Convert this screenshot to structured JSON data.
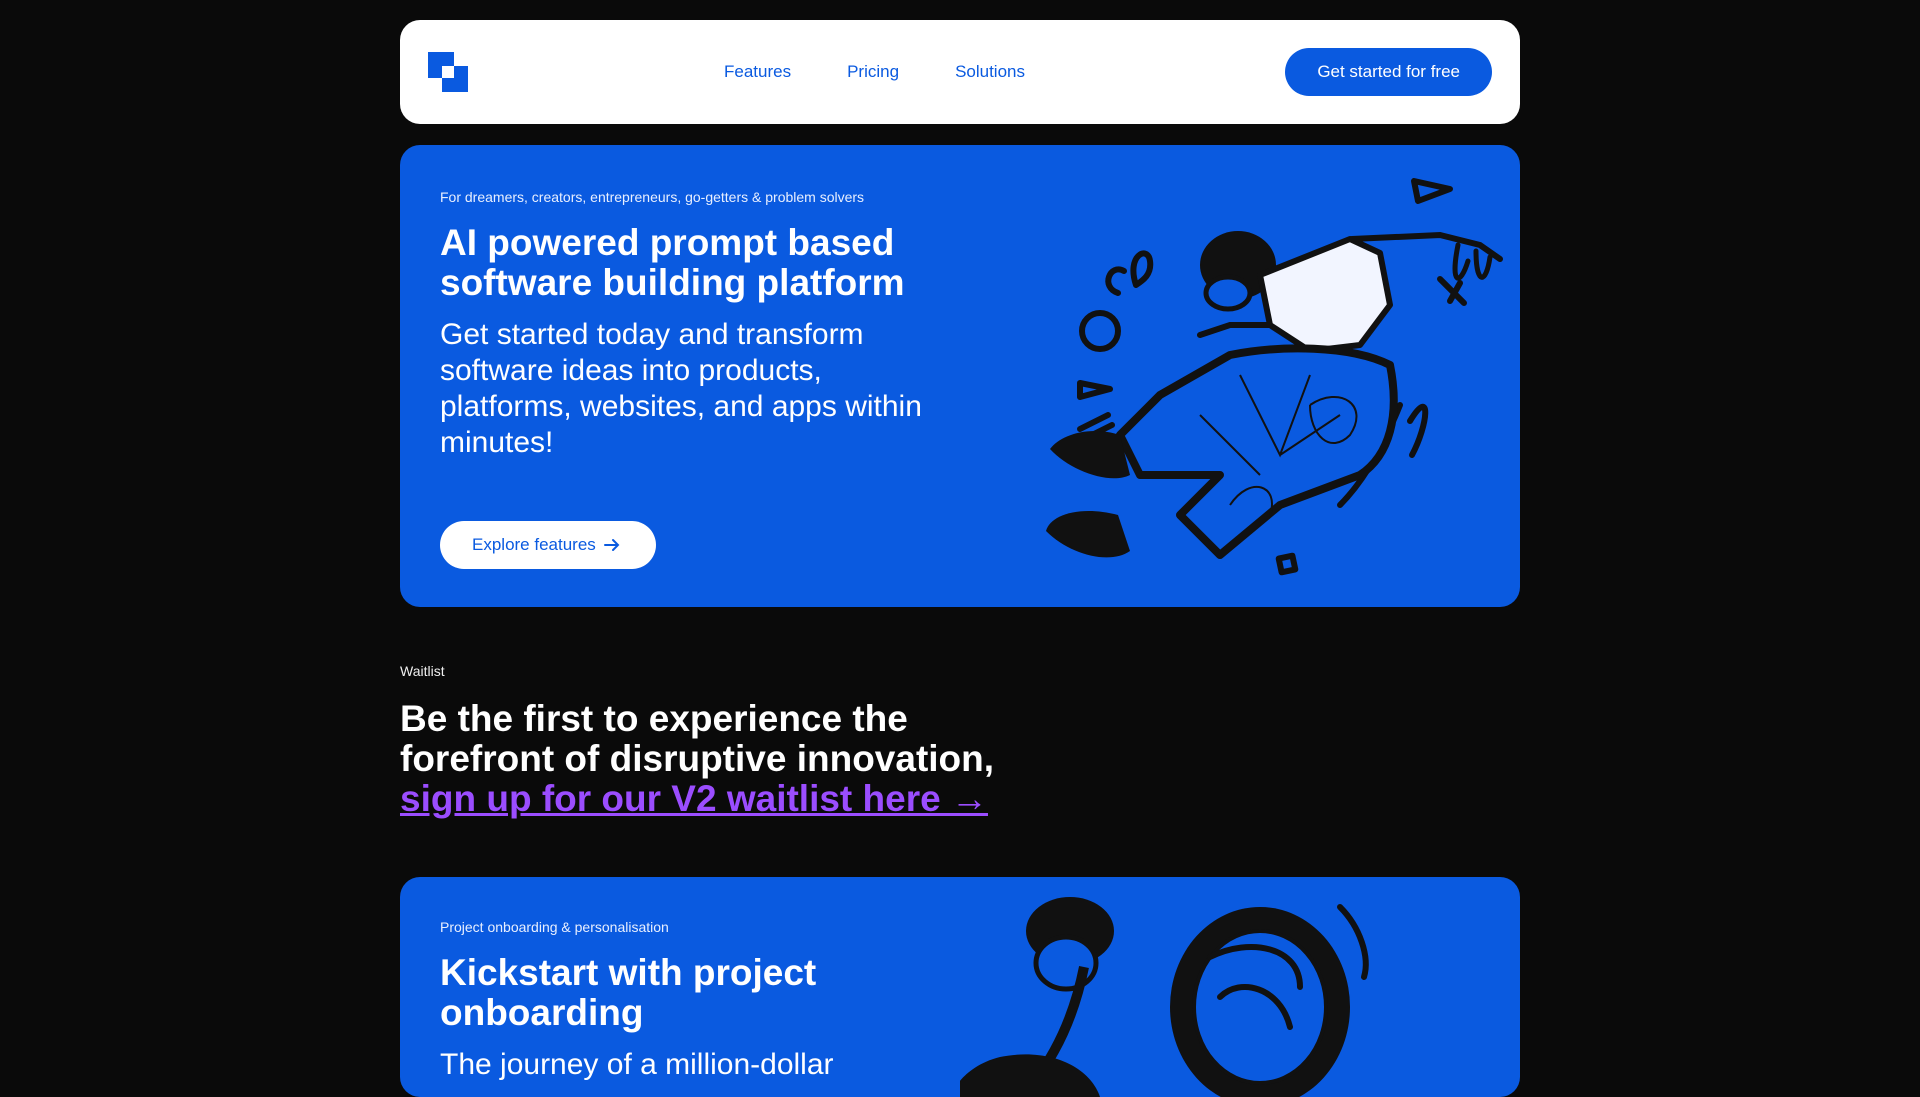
{
  "header": {
    "nav": [
      "Features",
      "Pricing",
      "Solutions"
    ],
    "cta_label": "Get started for free"
  },
  "hero": {
    "kicker": "For dreamers, creators, entrepreneurs, go-getters & problem solvers",
    "title": "AI powered prompt based software building platform",
    "subtitle": "Get started today and transform software ideas into products, platforms, websites, and apps within minutes!",
    "button_label": "Explore features"
  },
  "waitlist": {
    "label": "Waitlist",
    "heading": "Be the first to experience the forefront of disruptive innovation,",
    "link_text": "sign up for our V2 waitlist here →"
  },
  "onboarding": {
    "kicker": "Project onboarding & personalisation",
    "title": "Kickstart with project onboarding",
    "subtitle": "The journey of a million-dollar"
  },
  "colors": {
    "brand": "#0a5ae0",
    "background": "#0a0a0a",
    "link": "#9b4dff"
  },
  "icons": [
    "logo-icon",
    "arrow-right-icon",
    "hero-illustration",
    "onboarding-illustration"
  ]
}
